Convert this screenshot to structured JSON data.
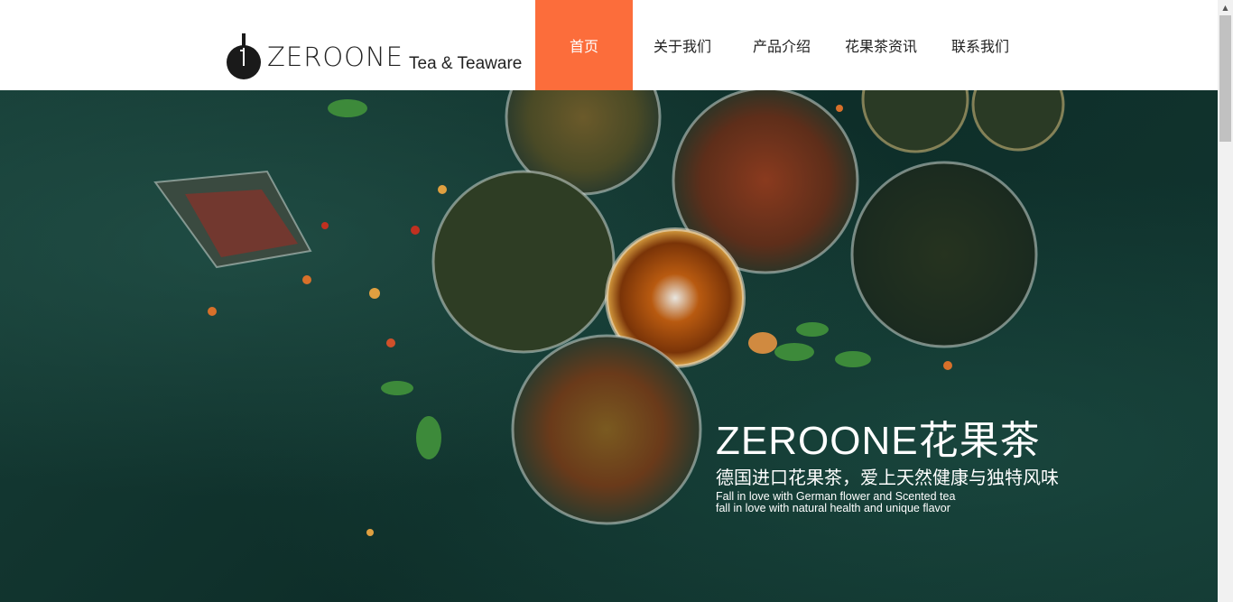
{
  "logo": {
    "word": "ZEROONE",
    "sub": "Tea & Teaware"
  },
  "nav": {
    "items": [
      {
        "label": "首页",
        "active": true
      },
      {
        "label": "关于我们"
      },
      {
        "label": "产品介绍"
      },
      {
        "label": "花果茶资讯"
      },
      {
        "label": "联系我们"
      }
    ]
  },
  "hero": {
    "title": "ZEROONE花果茶",
    "subtitle": "德国进口花果茶，爱上天然健康与独特风味",
    "english_line1": "Fall in love with German flower and Scented tea",
    "english_line2": "fall in love with natural health and unique flavor"
  },
  "colors": {
    "accent": "#fc6d3b",
    "hero_bg": "#123731"
  }
}
